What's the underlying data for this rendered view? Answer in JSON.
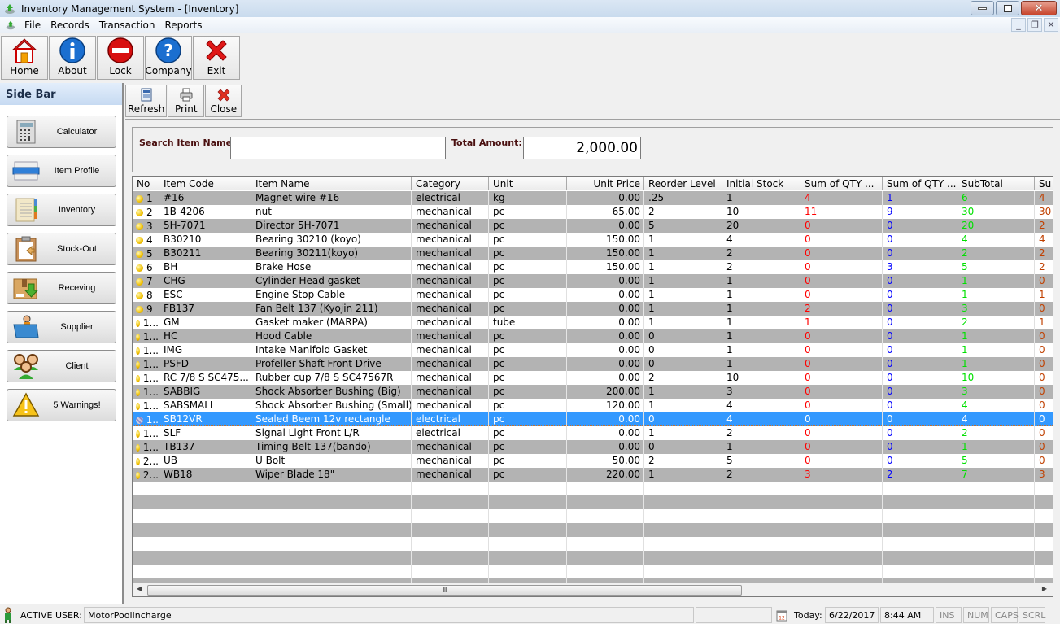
{
  "window": {
    "title": "Inventory Management System - [Inventory]"
  },
  "menu": {
    "items": [
      "File",
      "Records",
      "Transaction",
      "Reports"
    ]
  },
  "toolbar": {
    "buttons": [
      {
        "label": "Home",
        "icon": "home-icon"
      },
      {
        "label": "About",
        "icon": "info-icon"
      },
      {
        "label": "Lock",
        "icon": "lock-icon"
      },
      {
        "label": "Company",
        "icon": "help-icon"
      },
      {
        "label": "Exit",
        "icon": "exit-icon"
      }
    ]
  },
  "sidebar": {
    "title": "Side Bar",
    "items": [
      {
        "label": "Calculator",
        "accel": "C",
        "rest": "alculator",
        "icon": "calculator-icon"
      },
      {
        "label": "Item Profile",
        "accel": "I",
        "rest": "tem Profile",
        "icon": "item-profile-icon"
      },
      {
        "label": "Inventory",
        "accel": "n",
        "pre": "I",
        "rest": "ventory",
        "icon": "inventory-icon"
      },
      {
        "label": "Stock-Out",
        "accel": "S",
        "rest": "tock-Out",
        "icon": "stock-out-icon"
      },
      {
        "label": "Receving",
        "accel": "R",
        "rest": "eceving",
        "icon": "receiving-icon"
      },
      {
        "label": "Supplier",
        "accel": "S",
        "rest": "upplier",
        "icon": "supplier-icon"
      },
      {
        "label": "Client",
        "accel": "C",
        "rest": "lient",
        "icon": "client-icon"
      },
      {
        "label": "5 Warnings!",
        "icon": "warning-icon"
      }
    ]
  },
  "subtoolbar": {
    "refresh": "Refresh",
    "print": "Print",
    "close": "Close"
  },
  "search": {
    "label": "Search Item Name:",
    "value": "",
    "total_label": "Total Amount:",
    "total_value": "2,000.00"
  },
  "colors": {
    "sum_qty_in": "#ff0000",
    "sum_qty_out": "#0000ff",
    "subtotal": "#00e000",
    "last_col": "#c04000",
    "selection": "#3399ff",
    "alt_row": "#b3b3b3"
  },
  "grid": {
    "columns": [
      "No",
      "Item Code",
      "Item Name",
      "Category",
      "Unit",
      "Unit Price",
      "Reorder Level",
      "Initial Stock",
      "Sum of QTY ...",
      "Sum of QTY ...",
      "SubTotal",
      "Su"
    ],
    "selected_row": 16,
    "rows": [
      {
        "no": "1",
        "code": "#16",
        "name": "Magnet wire #16",
        "category": "electrical",
        "unit": "kg",
        "price": "0.00",
        "reorder": ".25",
        "initial": "1",
        "qty1": "4",
        "qty2": "1",
        "subtotal": "6",
        "last": "4"
      },
      {
        "no": "2",
        "code": "1B-4206",
        "name": "nut",
        "category": "mechanical",
        "unit": "pc",
        "price": "65.00",
        "reorder": "2",
        "initial": "10",
        "qty1": "11",
        "qty2": "9",
        "subtotal": "30",
        "last": "30"
      },
      {
        "no": "3",
        "code": "5H-7071",
        "name": "Director 5H-7071",
        "category": "mechanical",
        "unit": "pc",
        "price": "0.00",
        "reorder": "5",
        "initial": "20",
        "qty1": "0",
        "qty2": "0",
        "subtotal": "20",
        "last": "2"
      },
      {
        "no": "4",
        "code": "B30210",
        "name": "Bearing 30210 (koyo)",
        "category": "mechanical",
        "unit": "pc",
        "price": "150.00",
        "reorder": "1",
        "initial": "4",
        "qty1": "0",
        "qty2": "0",
        "subtotal": "4",
        "last": "4"
      },
      {
        "no": "5",
        "code": "B30211",
        "name": "Bearing 30211(koyo)",
        "category": "mechanical",
        "unit": "pc",
        "price": "150.00",
        "reorder": "1",
        "initial": "2",
        "qty1": "0",
        "qty2": "0",
        "subtotal": "2",
        "last": "2"
      },
      {
        "no": "6",
        "code": "BH",
        "name": "Brake Hose",
        "category": "mechanical",
        "unit": "pc",
        "price": "150.00",
        "reorder": "1",
        "initial": "2",
        "qty1": "0",
        "qty2": "3",
        "subtotal": "5",
        "last": "2"
      },
      {
        "no": "7",
        "code": "CHG",
        "name": "Cylinder Head gasket",
        "category": "mechanical",
        "unit": "pc",
        "price": "0.00",
        "reorder": "1",
        "initial": "1",
        "qty1": "0",
        "qty2": "0",
        "subtotal": "1",
        "last": "0"
      },
      {
        "no": "8",
        "code": "ESC",
        "name": "Engine Stop Cable",
        "category": "mechanical",
        "unit": "pc",
        "price": "0.00",
        "reorder": "1",
        "initial": "1",
        "qty1": "0",
        "qty2": "0",
        "subtotal": "1",
        "last": "1"
      },
      {
        "no": "9",
        "code": "FB137",
        "name": "Fan Belt 137 (Kyojin 211)",
        "category": "mechanical",
        "unit": "pc",
        "price": "0.00",
        "reorder": "1",
        "initial": "1",
        "qty1": "2",
        "qty2": "0",
        "subtotal": "3",
        "last": "0"
      },
      {
        "no": "1...",
        "code": "GM",
        "name": "Gasket maker (MARPA)",
        "category": "mechanical",
        "unit": "tube",
        "price": "0.00",
        "reorder": "1",
        "initial": "1",
        "qty1": "1",
        "qty2": "0",
        "subtotal": "2",
        "last": "1"
      },
      {
        "no": "1...",
        "code": "HC",
        "name": "Hood Cable",
        "category": "mechanical",
        "unit": "pc",
        "price": "0.00",
        "reorder": "0",
        "initial": "1",
        "qty1": "0",
        "qty2": "0",
        "subtotal": "1",
        "last": "0"
      },
      {
        "no": "1...",
        "code": "IMG",
        "name": "Intake Manifold Gasket",
        "category": "mechanical",
        "unit": "pc",
        "price": "0.00",
        "reorder": "0",
        "initial": "1",
        "qty1": "0",
        "qty2": "0",
        "subtotal": "1",
        "last": "0"
      },
      {
        "no": "1...",
        "code": "PSFD",
        "name": "Profeller Shaft Front Drive",
        "category": "mechanical",
        "unit": "pc",
        "price": "0.00",
        "reorder": "0",
        "initial": "1",
        "qty1": "0",
        "qty2": "0",
        "subtotal": "1",
        "last": "0"
      },
      {
        "no": "1...",
        "code": "RC 7/8 S SC475...",
        "name": "Rubber cup 7/8 S SC47567R",
        "category": "mechanical",
        "unit": "pc",
        "price": "0.00",
        "reorder": "2",
        "initial": "10",
        "qty1": "0",
        "qty2": "0",
        "subtotal": "10",
        "last": "0"
      },
      {
        "no": "1...",
        "code": "SABBIG",
        "name": "Shock Absorber Bushing (Big)",
        "category": "mechanical",
        "unit": "pc",
        "price": "200.00",
        "reorder": "1",
        "initial": "3",
        "qty1": "0",
        "qty2": "0",
        "subtotal": "3",
        "last": "0"
      },
      {
        "no": "1...",
        "code": "SABSMALL",
        "name": "Shock Absorber Bushing (Small)",
        "category": "mechanical",
        "unit": "pc",
        "price": "120.00",
        "reorder": "1",
        "initial": "4",
        "qty1": "0",
        "qty2": "0",
        "subtotal": "4",
        "last": "0"
      },
      {
        "no": "1..",
        "code": "SB12VR",
        "name": "Sealed Beem 12v rectangle",
        "category": "electrical",
        "unit": "pc",
        "price": "0.00",
        "reorder": "0",
        "initial": "4",
        "qty1": "0",
        "qty2": "0",
        "subtotal": "4",
        "last": "0"
      },
      {
        "no": "1...",
        "code": "SLF",
        "name": "Signal Light Front L/R",
        "category": "electrical",
        "unit": "pc",
        "price": "0.00",
        "reorder": "1",
        "initial": "2",
        "qty1": "0",
        "qty2": "0",
        "subtotal": "2",
        "last": "0"
      },
      {
        "no": "1...",
        "code": "TB137",
        "name": "Timing Belt 137(bando)",
        "category": "mechanical",
        "unit": "pc",
        "price": "0.00",
        "reorder": "0",
        "initial": "1",
        "qty1": "0",
        "qty2": "0",
        "subtotal": "1",
        "last": "0"
      },
      {
        "no": "2...",
        "code": "UB",
        "name": "U Bolt",
        "category": "mechanical",
        "unit": "pc",
        "price": "50.00",
        "reorder": "2",
        "initial": "5",
        "qty1": "0",
        "qty2": "0",
        "subtotal": "5",
        "last": "0"
      },
      {
        "no": "2...",
        "code": "WB18",
        "name": "Wiper Blade 18\"",
        "category": "mechanical",
        "unit": "pc",
        "price": "220.00",
        "reorder": "1",
        "initial": "2",
        "qty1": "3",
        "qty2": "2",
        "subtotal": "7",
        "last": "3"
      }
    ],
    "empty_rows": 8,
    "scrollbar_grip": "III"
  },
  "statusbar": {
    "active_user_label": "ACTIVE USER:",
    "active_user": "MotorPoolIncharge",
    "today_label": "Today:",
    "date": "6/22/2017",
    "time": "8:44 AM",
    "indicators": [
      "INS",
      "NUM",
      "CAPS",
      "SCRL"
    ]
  }
}
